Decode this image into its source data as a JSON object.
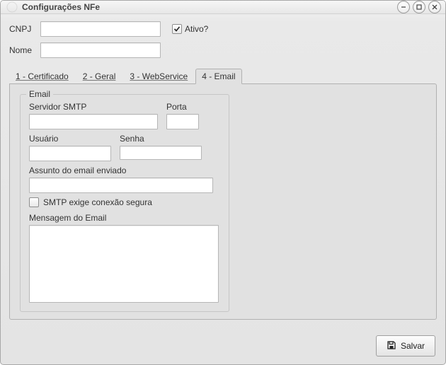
{
  "window": {
    "title": "Configurações NFe"
  },
  "header": {
    "cnpj_label": "CNPJ",
    "cnpj_value": "",
    "nome_label": "Nome",
    "nome_value": "",
    "ativo_label": "Ativo?",
    "ativo_checked": true
  },
  "tabs": [
    {
      "label": "1 - Certificado",
      "active": false
    },
    {
      "label": "2 - Geral",
      "active": false
    },
    {
      "label": "3 - WebService",
      "active": false
    },
    {
      "label": "4 - Email",
      "active": true
    }
  ],
  "email_panel": {
    "legend": "Email",
    "servidor_label": "Servidor SMTP",
    "servidor_value": "",
    "porta_label": "Porta",
    "porta_value": "",
    "usuario_label": "Usuário",
    "usuario_value": "",
    "senha_label": "Senha",
    "senha_value": "",
    "assunto_label": "Assunto do email enviado",
    "assunto_value": "",
    "ssl_label": "SMTP exige conexão segura",
    "ssl_checked": false,
    "mensagem_label": "Mensagem do Email",
    "mensagem_value": ""
  },
  "footer": {
    "save_label": "Salvar"
  }
}
